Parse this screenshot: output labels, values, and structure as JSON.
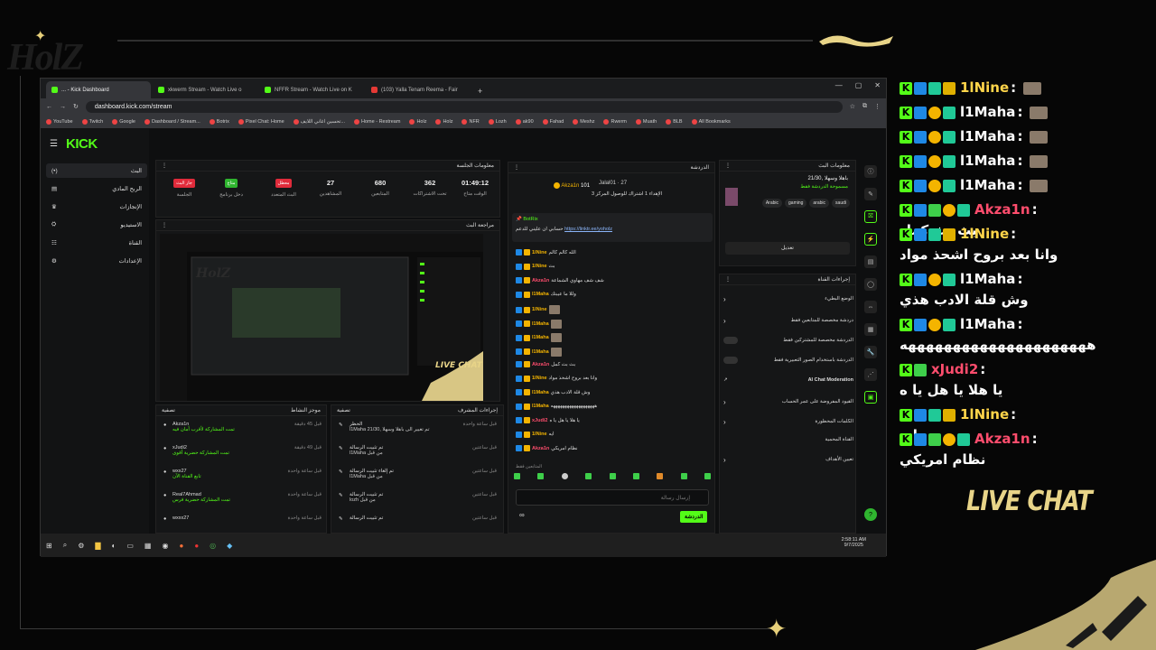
{
  "overlay": {
    "logo_text": "HolZ",
    "live_chat_label": "LIVE CHAT"
  },
  "browser": {
    "tabs": [
      {
        "label": "... - Kick Dashboard",
        "color": "#53fc18",
        "active": true
      },
      {
        "label": "xkwerm Stream - Watch Live o",
        "color": "#53fc18",
        "active": false
      },
      {
        "label": "NFFR Stream - Watch Live on K",
        "color": "#53fc18",
        "active": false
      },
      {
        "label": "(103) Yalla Tenam Reema - Fair",
        "color": "#e53935",
        "active": false
      }
    ],
    "new_tab": "+",
    "url": "dashboard.kick.com/stream",
    "bookmarks": [
      "YouTube",
      "Twitch",
      "Google",
      "Dashboard / Stream...",
      "Botrix",
      "Pixel Chat: Home",
      "تحسين اغاني اللايف...",
      "Home - Restream",
      "Holz",
      "Holz",
      "NFR",
      "Lozh",
      "ak90",
      "Fahad",
      "Meshz",
      "Rwerm",
      "Muath",
      "BLB",
      "All Bookmarks"
    ]
  },
  "dashboard": {
    "logo": "KICK",
    "sidebar": [
      {
        "label": "البث",
        "icon": "(•)"
      },
      {
        "label": "الربح المادي",
        "icon": "▤"
      },
      {
        "label": "الإنجازات",
        "icon": "♛"
      },
      {
        "label": "الاستيديو",
        "icon": "⛭"
      },
      {
        "label": "القناة",
        "icon": "☷"
      },
      {
        "label": "الإعدادات",
        "icon": "⚙"
      }
    ],
    "session_info": {
      "title": "معلومات الجلسة",
      "stats": [
        {
          "value": "01:49:12",
          "label": "الوقت متاح"
        },
        {
          "value": "362",
          "label": "تحت الاشتراكات"
        },
        {
          "value": "680",
          "label": "المتابعين"
        },
        {
          "value": "27",
          "label": "المشاهدين"
        },
        {
          "badge": "معطل",
          "badge_color": "#e02b3b",
          "label": "البث المتعدد"
        },
        {
          "badge": "متاح",
          "badge_color": "#2fb52f",
          "label": "دخل برنامج"
        },
        {
          "badge": "جار البث",
          "badge_color": "#e02b3b",
          "label": "الجلسة"
        }
      ]
    },
    "preview_title": "مراجعة البث",
    "activity": {
      "title": "موجز النشاط",
      "filter": "تصفية",
      "items": [
        {
          "user": "Akza1n",
          "sub": "تمت المشاركة لأقرب أمان فيه",
          "time": "قبل 45 دقيقة"
        },
        {
          "user": "xJudi2",
          "sub": "تمت المشاركة حضرية أقوى",
          "time": "قبل 49 دقيقة"
        },
        {
          "user": "wxx27",
          "sub": "تابع القناة الآن",
          "time": "قبل ساعة واحدة"
        },
        {
          "user": "Real7Ahmad",
          "sub": "تمت المشاركة حضرية فرس",
          "time": "قبل ساعة واحدة"
        },
        {
          "user": "wxxx27",
          "sub": "",
          "time": "قبل ساعة واحدة"
        }
      ]
    },
    "mod_actions": {
      "title": "إجراءات المشرف",
      "filter": "تصفية",
      "items": [
        {
          "title": "الحظر",
          "sub": "l1Maha تم تغيير الى باهلا وسهلا ,21/30",
          "time": "قبل ساعة واحدة"
        },
        {
          "title": "تم تثبيت الرسالة",
          "sub": "l1Maha من قبل",
          "time": "قبل ساعتين"
        },
        {
          "title": "تم إلغاء تثبيت الرسالة",
          "sub": "l1Maha من قبل",
          "time": "قبل ساعتين"
        },
        {
          "title": "تم تثبيت الرسالة",
          "sub": "lozh من قبل",
          "time": "قبل ساعتين"
        },
        {
          "title": "تم تثبيت الرسالة",
          "sub": "",
          "time": "قبل ساعتين"
        }
      ]
    },
    "chat": {
      "title": "الدردشة",
      "top_user": "Akza1n",
      "top_count": "101",
      "other_user": "Jalal01",
      "other_count": "27",
      "goal_text": "الإهداء 1 اشتراك للوصول المركز 3",
      "pinned_user": "BotRix",
      "pinned_text": "حسابي ان عليني للدعم",
      "pinned_link": "https://linktr.ee/yoholz",
      "messages": [
        {
          "user": "1lNine",
          "text": "الله كالم كالم",
          "color": "#f4b400"
        },
        {
          "user": "1lNine",
          "text": "بث",
          "color": "#f4b400"
        },
        {
          "user": "Akza1n",
          "text": "شف شف مهاوي الشماعة",
          "color": "#ff4d6d"
        },
        {
          "user": "l1Maha",
          "text": "وللا ما عيبتك",
          "color": "#f4b400"
        },
        {
          "user": "1lNine",
          "text": "",
          "color": "#f4b400"
        },
        {
          "user": "l1Maha",
          "text": "",
          "color": "#f4b400"
        },
        {
          "user": "l1Maha",
          "text": "",
          "color": "#f4b400"
        },
        {
          "user": "l1Maha",
          "text": "",
          "color": "#f4b400"
        },
        {
          "user": "Akza1n",
          "text": "بث بث كمل",
          "color": "#ff4d6d"
        },
        {
          "user": "1lNine",
          "text": "وانا بعد بروح اشحذ مواد",
          "color": "#f4b400"
        },
        {
          "user": "l1Maha",
          "text": "وش قلة الادب هذي",
          "color": "#f4b400"
        },
        {
          "user": "l1Maha",
          "text": "هههههههههههههههههههه",
          "color": "#f4b400"
        },
        {
          "user": "xJudi2",
          "text": "يا هلا يا هل يا ه",
          "color": "#ff4d6d"
        },
        {
          "user": "1lNine",
          "text": "ايه",
          "color": "#f4b400"
        },
        {
          "user": "Akza1n",
          "text": "نظام امريكي",
          "color": "#ff4d6d"
        }
      ],
      "followers_only": "المتابعين فقط",
      "input_placeholder": "إرسال رسالة",
      "send_label": "الدردشة"
    },
    "stream_info": {
      "title": "معلومات البث",
      "stream_title": "باهلا وسهلا ,21/30",
      "category": "مسموحة الدردشة فقط",
      "tags": [
        "Arabic",
        "gaming",
        "arabic",
        "saudi"
      ],
      "edit_label": "تعديل"
    },
    "channel_actions": {
      "title": "إجراءات القناة",
      "items": [
        {
          "label": "الوضع البطيء",
          "control": "chevron"
        },
        {
          "label": "دردشة مخصصة للمتابعين فقط",
          "control": "chevron"
        },
        {
          "label": "الدردشة مخصصة للمشتركين فقط",
          "control": "toggle"
        },
        {
          "label": "الدردشة باستخدام الصور التعبيرية فقط",
          "control": "toggle"
        },
        {
          "label": "AI Chat Moderation",
          "control": "external"
        },
        {
          "label": "القيود المفروضة على عمر الحساب",
          "control": "chevron"
        },
        {
          "label": "الكلمات المحظورة",
          "control": "chevron"
        },
        {
          "label": "القناة المحمية",
          "control": "none"
        },
        {
          "label": "تعيين الأهداف",
          "control": "chevron"
        }
      ]
    }
  },
  "taskbar": {
    "time": "2:58:11 AM",
    "date": "9/7/2025"
  },
  "live_chat": [
    {
      "badges": [
        "k",
        "blue",
        "teal",
        "crown"
      ],
      "user": "1lNine",
      "user_color": "#ffd54a",
      "text": "",
      "emote": true
    },
    {
      "badges": [
        "k",
        "blue",
        "gold",
        "teal"
      ],
      "user": "l1Maha",
      "user_color": "#ffffff",
      "text": "",
      "emote": true
    },
    {
      "badges": [
        "k",
        "blue",
        "gold",
        "teal"
      ],
      "user": "l1Maha",
      "user_color": "#ffffff",
      "text": "",
      "emote": true
    },
    {
      "badges": [
        "k",
        "blue",
        "gold",
        "teal"
      ],
      "user": "l1Maha",
      "user_color": "#ffffff",
      "text": "",
      "emote": true
    },
    {
      "badges": [
        "k",
        "blue",
        "gold",
        "teal"
      ],
      "user": "l1Maha",
      "user_color": "#ffffff",
      "text": "",
      "emote": true
    },
    {
      "badges": [
        "k",
        "blue",
        "green",
        "gold",
        "teal"
      ],
      "user": "Akza1n",
      "user_color": "#ff4d6d",
      "text": "بث بث كمل",
      "emote": false
    },
    {
      "badges": [
        "k",
        "blue",
        "teal",
        "crown"
      ],
      "user": "1lNine",
      "user_color": "#ffd54a",
      "text": "وانا بعد بروح اشحذ مواد",
      "emote": false
    },
    {
      "badges": [
        "k",
        "blue",
        "gold",
        "teal"
      ],
      "user": "l1Maha",
      "user_color": "#ffffff",
      "text": "وش قلة الادب هذي",
      "emote": false
    },
    {
      "badges": [
        "k",
        "blue",
        "gold",
        "teal"
      ],
      "user": "l1Maha",
      "user_color": "#ffffff",
      "text": "هههههههههههههههههههههه",
      "emote": false
    },
    {
      "badges": [
        "k",
        "green"
      ],
      "user": "xJudi2",
      "user_color": "#ff4d6d",
      "text": "يا هلا يا هل يا ه",
      "emote": false
    },
    {
      "badges": [
        "k",
        "blue",
        "teal",
        "crown"
      ],
      "user": "1lNine",
      "user_color": "#ffd54a",
      "text": "ايه",
      "emote": false
    },
    {
      "badges": [
        "k",
        "blue",
        "green",
        "gold",
        "teal"
      ],
      "user": "Akza1n",
      "user_color": "#ff4d6d",
      "text": "نظام امريكي",
      "emote": false
    }
  ]
}
